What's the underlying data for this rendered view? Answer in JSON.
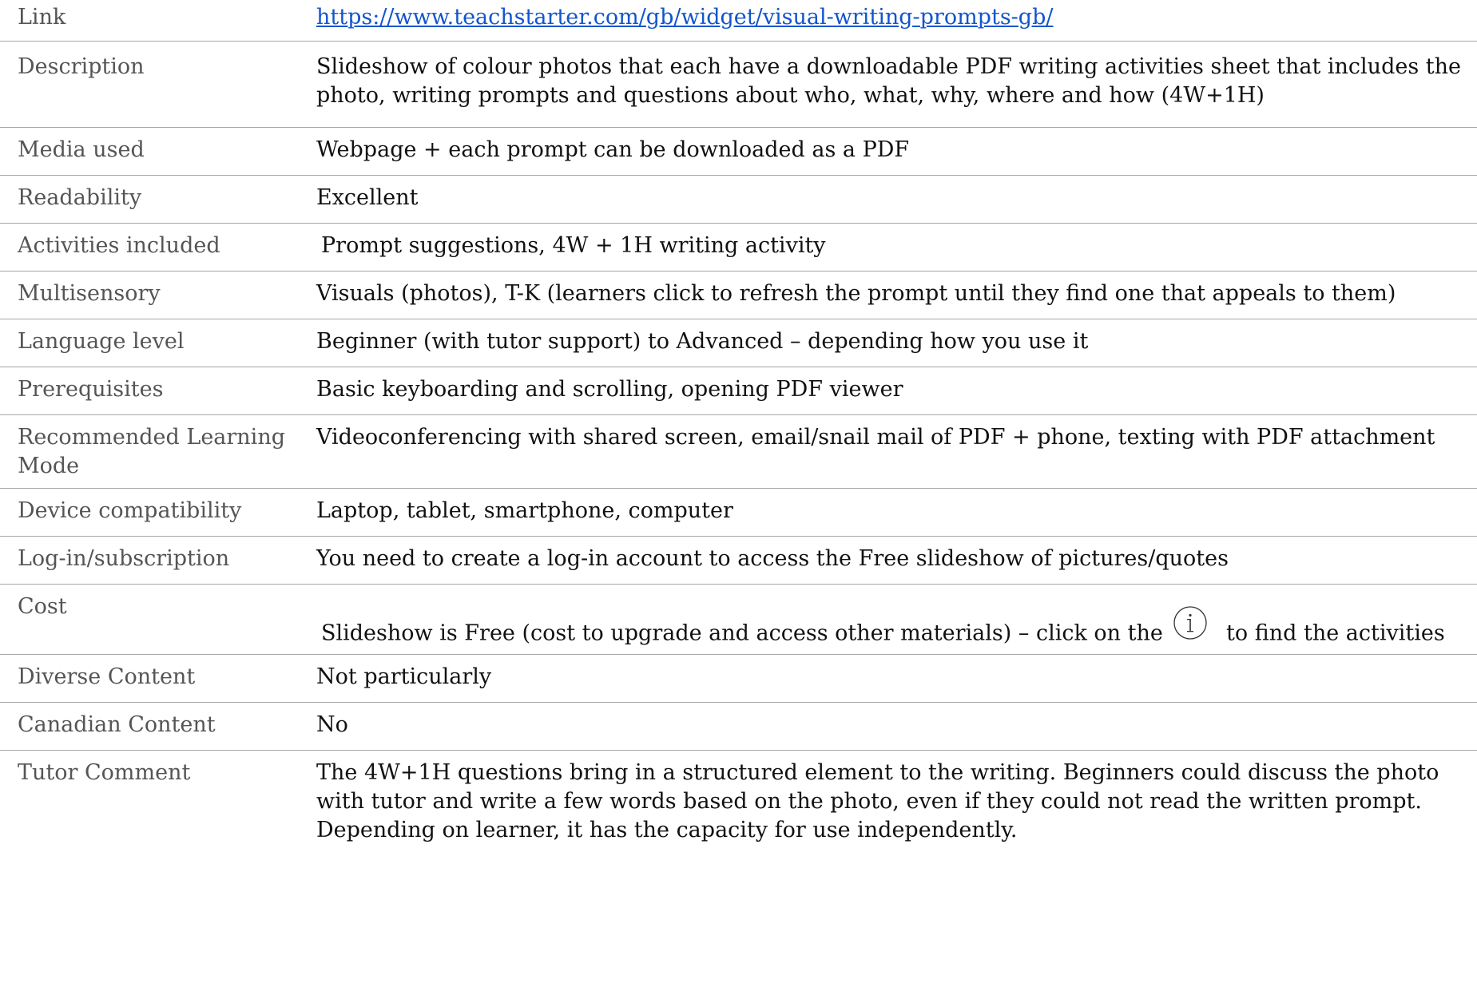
{
  "rows": [
    {
      "label": "Link",
      "value": "https://www.teachstarter.com/gb/widget/visual-writing-prompts-gb/"
    },
    {
      "label": "Description",
      "value": "Slideshow of colour photos that each have a downloadable PDF writing activities sheet that includes the photo, writing prompts and questions about who, what, why, where and how (4W+1H)"
    },
    {
      "label": "Media used",
      "value": "Webpage + each prompt can be downloaded as a PDF"
    },
    {
      "label": "Readability",
      "value": "Excellent"
    },
    {
      "label": "Activities included",
      "value": "Prompt suggestions, 4W + 1H writing activity"
    },
    {
      "label": "Multisensory",
      "value": "Visuals (photos), T-K (learners click to refresh the prompt until they find one that appeals to them)"
    },
    {
      "label": "Language level",
      "value": "Beginner (with tutor support) to Advanced – depending how you use it"
    },
    {
      "label": "Prerequisites",
      "value": "Basic keyboarding and scrolling, opening PDF viewer"
    },
    {
      "label": "Recommended Learning Mode",
      "value": "Videoconferencing with shared screen, email/snail mail of PDF + phone, texting with PDF attachment"
    },
    {
      "label": "Device compatibility",
      "value": "Laptop, tablet, smartphone, computer"
    },
    {
      "label": "Log-in/subscription",
      "value": "You need to create a log-in account to access the Free slideshow of pictures/quotes"
    },
    {
      "label": "Cost",
      "value_before_icon": "Slideshow is Free (cost to upgrade and access other materials) – click on the",
      "value_after_icon": "to find the activities",
      "icon": "info-circle-icon"
    },
    {
      "label": "Diverse Content",
      "value": "Not particularly"
    },
    {
      "label": "Canadian Content",
      "value": "No"
    },
    {
      "label": "Tutor Comment",
      "value": "The 4W+1H questions bring in a structured element to the writing. Beginners could discuss the photo with tutor and write a few words based on the photo, even if they could not read the written prompt. Depending on learner, it has the capacity for use independently."
    }
  ],
  "colors": {
    "label_text": "#555555",
    "value_text": "#111111",
    "link": "#1155cc",
    "rule": "#a6a6a6"
  }
}
